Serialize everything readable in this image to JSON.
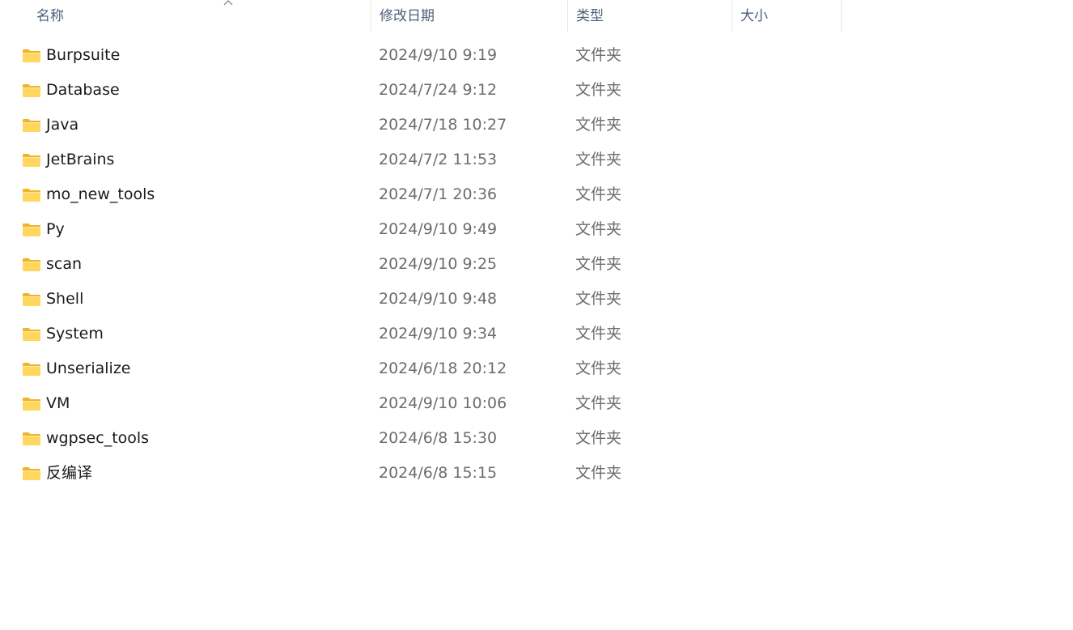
{
  "columns": {
    "name": "名称",
    "date": "修改日期",
    "type": "类型",
    "size": "大小"
  },
  "sort": {
    "column": "name",
    "direction": "ascending",
    "icon": "chevron-up-icon"
  },
  "colors": {
    "header_text": "#4c607a",
    "name_text": "#1a1a1a",
    "meta_text": "#6d6d6d",
    "folder_body": "#ffd75e",
    "folder_tab": "#f0b429"
  },
  "files": [
    {
      "name": "Burpsuite",
      "date": "2024/9/10 9:19",
      "type": "文件夹",
      "size": "",
      "icon": "folder-icon"
    },
    {
      "name": "Database",
      "date": "2024/7/24 9:12",
      "type": "文件夹",
      "size": "",
      "icon": "folder-icon"
    },
    {
      "name": "Java",
      "date": "2024/7/18 10:27",
      "type": "文件夹",
      "size": "",
      "icon": "folder-icon"
    },
    {
      "name": "JetBrains",
      "date": "2024/7/2 11:53",
      "type": "文件夹",
      "size": "",
      "icon": "folder-icon"
    },
    {
      "name": "mo_new_tools",
      "date": "2024/7/1 20:36",
      "type": "文件夹",
      "size": "",
      "icon": "folder-icon"
    },
    {
      "name": "Py",
      "date": "2024/9/10 9:49",
      "type": "文件夹",
      "size": "",
      "icon": "folder-icon"
    },
    {
      "name": "scan",
      "date": "2024/9/10 9:25",
      "type": "文件夹",
      "size": "",
      "icon": "folder-icon"
    },
    {
      "name": "Shell",
      "date": "2024/9/10 9:48",
      "type": "文件夹",
      "size": "",
      "icon": "folder-icon"
    },
    {
      "name": "System",
      "date": "2024/9/10 9:34",
      "type": "文件夹",
      "size": "",
      "icon": "folder-icon"
    },
    {
      "name": "Unserialize",
      "date": "2024/6/18 20:12",
      "type": "文件夹",
      "size": "",
      "icon": "folder-icon"
    },
    {
      "name": "VM",
      "date": "2024/9/10 10:06",
      "type": "文件夹",
      "size": "",
      "icon": "folder-icon"
    },
    {
      "name": "wgpsec_tools",
      "date": "2024/6/8 15:30",
      "type": "文件夹",
      "size": "",
      "icon": "folder-icon"
    },
    {
      "name": "反编译",
      "date": "2024/6/8 15:15",
      "type": "文件夹",
      "size": "",
      "icon": "folder-icon"
    }
  ]
}
